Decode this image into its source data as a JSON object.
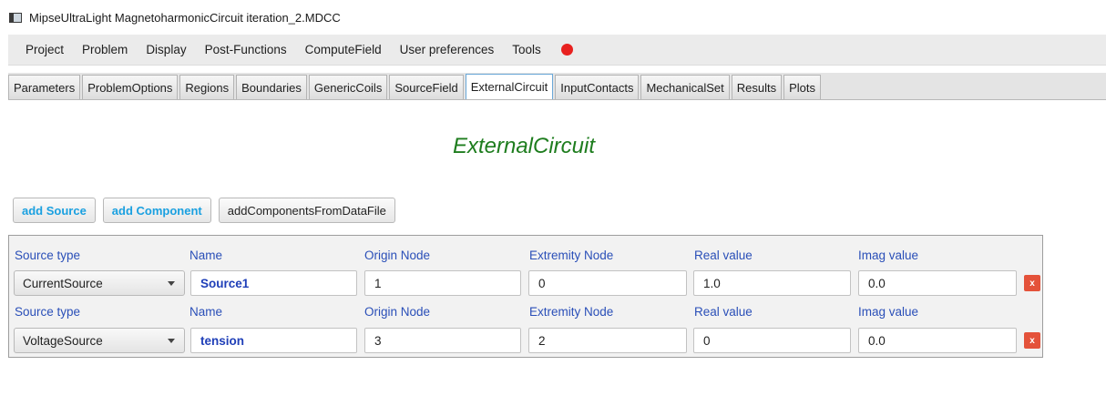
{
  "window": {
    "title": "MipseUltraLight MagnetoharmonicCircuit iteration_2.MDCC",
    "icon": "window-app-icon"
  },
  "menu": {
    "items": [
      "Project",
      "Problem",
      "Display",
      "Post-Functions",
      "ComputeField",
      "User preferences",
      "Tools"
    ],
    "record_indicator_color": "#e8211f"
  },
  "tabs": {
    "items": [
      "Parameters",
      "ProblemOptions",
      "Regions",
      "Boundaries",
      "GenericCoils",
      "SourceField",
      "ExternalCircuit",
      "InputContacts",
      "MechanicalSet",
      "Results",
      "Plots"
    ],
    "active": "ExternalCircuit"
  },
  "page": {
    "heading": "ExternalCircuit",
    "heading_color": "#1e7d1e"
  },
  "actions": {
    "add_source": "add Source",
    "add_component": "add Component",
    "add_from_file": "addComponentsFromDataFile"
  },
  "grid": {
    "headers": {
      "source_type": "Source type",
      "name": "Name",
      "origin_node": "Origin Node",
      "extremity_node": "Extremity Node",
      "real_value": "Real value",
      "imag_value": "Imag value"
    },
    "rows": [
      {
        "source_type": "CurrentSource",
        "name": "Source1",
        "origin_node": "1",
        "extremity_node": "0",
        "real_value": "1.0",
        "imag_value": "0.0",
        "delete_label": "x"
      },
      {
        "source_type": "VoltageSource",
        "name": "tension",
        "origin_node": "3",
        "extremity_node": "2",
        "real_value": "0",
        "imag_value": "0.0",
        "delete_label": "x"
      }
    ],
    "header_color": "#2a4fb8",
    "name_color": "#1f3fb8",
    "delete_color": "#e4523a"
  }
}
